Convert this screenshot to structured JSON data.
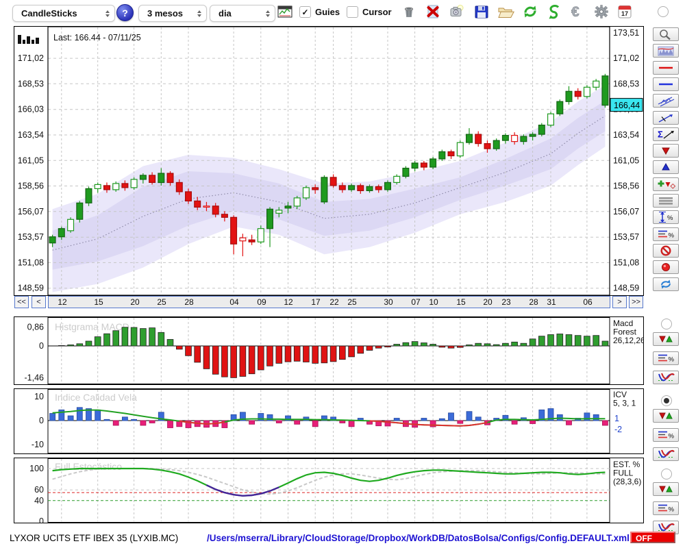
{
  "toolbar": {
    "chart_type": "CandleSticks",
    "period": "3 mesos",
    "timeframe": "dia",
    "help_label": "?",
    "guies_label": "Guies",
    "guies_checked": true,
    "cursor_label": "Cursor",
    "cursor_checked": false,
    "calendar_day": "17",
    "action_icons": [
      {
        "name": "trash-icon"
      },
      {
        "name": "delete-icon"
      },
      {
        "name": "snapshot-icon"
      },
      {
        "name": "save-icon"
      },
      {
        "name": "open-folder-icon"
      },
      {
        "name": "refresh-icon"
      },
      {
        "name": "sync-icon"
      },
      {
        "name": "euro-icon"
      },
      {
        "name": "settings-gear-icon"
      },
      {
        "name": "calendar-icon"
      }
    ]
  },
  "scrollbar": {
    "left_fast": "<<",
    "left": "<",
    "right": ">",
    "right_fast": ">>"
  },
  "sidebar": {
    "tools": [
      {
        "name": "zoom-tool"
      },
      {
        "name": "indicator-chart-tool"
      },
      {
        "name": "red-line-tool"
      },
      {
        "name": "blue-line-tool"
      },
      {
        "name": "channel-tool"
      },
      {
        "name": "trendline-tool"
      },
      {
        "name": "sigma-trend-tool"
      },
      {
        "name": "down-arrow-tool"
      },
      {
        "name": "up-arrow-tool"
      },
      {
        "name": "signal-markers-tool"
      },
      {
        "name": "levels-tool"
      },
      {
        "name": "range-percent-tool"
      },
      {
        "name": "lines-percent-tool"
      },
      {
        "name": "disable-tool"
      },
      {
        "name": "record-tool"
      },
      {
        "name": "refresh-chart-tool"
      }
    ],
    "panel_groups": [
      {
        "panel": "macd",
        "selected": false,
        "buttons": [
          "updown-arrows-tool",
          "lines-percent-tool",
          "curve-tool"
        ]
      },
      {
        "panel": "icv",
        "selected": true,
        "buttons": [
          "updown-arrows-tool",
          "lines-percent-tool",
          "curve-tool"
        ]
      },
      {
        "panel": "stoch",
        "selected": false,
        "buttons": [
          "updown-arrows-tool",
          "lines-percent-tool",
          "curve-tool"
        ]
      }
    ]
  },
  "status": {
    "symbol": "LYXOR UCITS ETF IBEX 35 (LYXIB.MC)",
    "config_path": "/Users/mserra/Library/CloudStorage/Dropbox/WorkDB/DatosBolsa/Configs/Config.DEFAULT.xml",
    "off_label": "OFF"
  },
  "colors": {
    "candle_up": "#1f9a1f",
    "candle_up_dark": "#156515",
    "candle_down": "#e31212",
    "candle_down_dark": "#a50d0d",
    "band_outer": "#eae7fa",
    "band_inner": "#dcd8f4",
    "band_mid": "#8e8aa8",
    "macd_up": "#2f9e2f",
    "macd_down": "#e01313",
    "icv_pos": "#3b6bd8",
    "icv_pos_dark": "#274a9e",
    "icv_neg": "#e81f78",
    "icv_neg_dark": "#aa1257",
    "icv_line": "#22a122",
    "icv_line_neg": "#e03030",
    "stoch_k": "#1faa1f",
    "stoch_d": "#c9c9c9",
    "stoch_purple": "#46249a",
    "level_red": "#dd2222",
    "level_green": "#2a9a2a",
    "price_tag": "#3ae6f0",
    "accent_blue": "#5577cc",
    "off_red": "#ea0000",
    "path_blue": "#1d12d2",
    "grid": "#c5c5c5",
    "watermark": "#cccccc"
  },
  "chart_data": [
    {
      "id": "main",
      "type": "candlestick",
      "last_label": "Last: 166.44 - 07/11/25",
      "last_price": 166.44,
      "last_price_label": "166,44",
      "ylim": [
        147.9,
        174.1
      ],
      "y_ticks": [
        171.02,
        168.53,
        166.03,
        163.54,
        161.05,
        158.56,
        156.07,
        153.57,
        151.08,
        148.59
      ],
      "y_tick_labels": [
        "171,02",
        "168,53",
        "166,03",
        "163,54",
        "161,05",
        "158,56",
        "156,07",
        "153,57",
        "151,08",
        "148,59"
      ],
      "top_partial_tick": 173.51,
      "top_partial_label": "173,51",
      "x_ticks": [
        {
          "label": "12",
          "i": 1
        },
        {
          "label": "15",
          "i": 5
        },
        {
          "label": "20",
          "i": 9
        },
        {
          "label": "25",
          "i": 12
        },
        {
          "label": "28",
          "i": 15
        },
        {
          "label": "04",
          "i": 20
        },
        {
          "label": "09",
          "i": 23
        },
        {
          "label": "12",
          "i": 26
        },
        {
          "label": "17",
          "i": 29
        },
        {
          "label": "22",
          "i": 31
        },
        {
          "label": "25",
          "i": 33
        },
        {
          "label": "30",
          "i": 37
        },
        {
          "label": "07",
          "i": 40
        },
        {
          "label": "10",
          "i": 42
        },
        {
          "label": "15",
          "i": 45
        },
        {
          "label": "20",
          "i": 48
        },
        {
          "label": "23",
          "i": 50
        },
        {
          "label": "28",
          "i": 53
        },
        {
          "label": "31",
          "i": 55
        },
        {
          "label": "06",
          "i": 59
        }
      ],
      "candles": [
        [
          153.0,
          153.8,
          152.6,
          153.6,
          "g"
        ],
        [
          153.6,
          154.6,
          153.3,
          154.4,
          "g"
        ],
        [
          154.2,
          155.5,
          154.0,
          155.3,
          "gh"
        ],
        [
          155.3,
          157.1,
          155.0,
          156.9,
          "g"
        ],
        [
          156.9,
          158.5,
          156.6,
          158.3,
          "g"
        ],
        [
          158.3,
          158.9,
          157.9,
          158.7,
          "gh"
        ],
        [
          158.6,
          158.9,
          157.9,
          158.2,
          "r"
        ],
        [
          158.2,
          159.0,
          158.0,
          158.8,
          "gh"
        ],
        [
          158.8,
          159.1,
          158.1,
          158.4,
          "r"
        ],
        [
          158.4,
          159.4,
          158.2,
          159.2,
          "gh"
        ],
        [
          159.2,
          159.8,
          158.8,
          159.6,
          "g"
        ],
        [
          159.6,
          159.9,
          158.7,
          158.9,
          "r"
        ],
        [
          158.9,
          160.3,
          158.6,
          159.8,
          "g"
        ],
        [
          159.8,
          160.0,
          158.6,
          158.9,
          "r"
        ],
        [
          158.9,
          159.2,
          157.7,
          158.0,
          "r"
        ],
        [
          158.0,
          158.3,
          156.8,
          157.1,
          "r"
        ],
        [
          157.1,
          157.5,
          156.2,
          156.5,
          "r"
        ],
        [
          156.5,
          157.0,
          156.1,
          156.6,
          "rh"
        ],
        [
          156.6,
          156.9,
          155.5,
          155.8,
          "r"
        ],
        [
          155.8,
          156.1,
          155.1,
          155.5,
          "r"
        ],
        [
          155.5,
          155.7,
          151.9,
          152.9,
          "r"
        ],
        [
          153.2,
          153.9,
          151.7,
          153.5,
          "rh"
        ],
        [
          153.3,
          153.8,
          152.8,
          153.1,
          "r"
        ],
        [
          153.1,
          154.7,
          152.9,
          154.4,
          "gh"
        ],
        [
          154.4,
          156.5,
          152.6,
          156.3,
          "g"
        ],
        [
          155.9,
          156.5,
          155.5,
          156.2,
          "gh"
        ],
        [
          156.4,
          157.0,
          155.9,
          156.6,
          "g"
        ],
        [
          156.6,
          157.6,
          156.3,
          157.4,
          "gh"
        ],
        [
          157.4,
          158.6,
          157.2,
          158.4,
          "gh"
        ],
        [
          158.4,
          158.7,
          157.8,
          158.2,
          "r"
        ],
        [
          157.0,
          159.6,
          156.8,
          159.4,
          "g"
        ],
        [
          159.4,
          159.7,
          158.4,
          158.6,
          "r"
        ],
        [
          158.6,
          158.9,
          157.9,
          158.2,
          "r"
        ],
        [
          158.2,
          158.8,
          158.0,
          158.6,
          "g"
        ],
        [
          158.6,
          158.8,
          157.8,
          158.1,
          "r"
        ],
        [
          158.1,
          158.7,
          157.9,
          158.5,
          "g"
        ],
        [
          158.5,
          158.7,
          157.9,
          158.2,
          "r"
        ],
        [
          158.2,
          159.1,
          158.0,
          158.9,
          "g"
        ],
        [
          158.9,
          159.7,
          158.7,
          159.5,
          "gh"
        ],
        [
          159.5,
          160.5,
          159.3,
          160.3,
          "g"
        ],
        [
          160.3,
          161.0,
          160.0,
          160.8,
          "g"
        ],
        [
          160.8,
          161.0,
          160.1,
          160.4,
          "r"
        ],
        [
          160.4,
          161.4,
          160.2,
          161.2,
          "g"
        ],
        [
          161.2,
          162.1,
          161.0,
          161.9,
          "g"
        ],
        [
          161.9,
          162.1,
          161.2,
          161.5,
          "r"
        ],
        [
          161.5,
          163.0,
          161.3,
          162.8,
          "gh"
        ],
        [
          162.8,
          164.2,
          162.6,
          163.6,
          "g"
        ],
        [
          163.6,
          163.9,
          162.4,
          162.7,
          "r"
        ],
        [
          162.7,
          163.0,
          161.8,
          162.2,
          "r"
        ],
        [
          162.2,
          163.2,
          162.0,
          163.0,
          "g"
        ],
        [
          163.0,
          163.7,
          162.7,
          163.5,
          "g"
        ],
        [
          163.5,
          163.8,
          162.6,
          162.9,
          "rh"
        ],
        [
          162.9,
          163.6,
          162.6,
          163.4,
          "g"
        ],
        [
          163.4,
          163.8,
          163.0,
          163.6,
          "g"
        ],
        [
          163.6,
          164.7,
          163.4,
          164.5,
          "g"
        ],
        [
          164.5,
          165.8,
          164.3,
          165.6,
          "gh"
        ],
        [
          165.6,
          167.0,
          165.4,
          166.8,
          "g"
        ],
        [
          166.8,
          168.3,
          166.5,
          167.8,
          "g"
        ],
        [
          167.8,
          168.1,
          167.0,
          167.3,
          "r"
        ],
        [
          167.3,
          168.4,
          167.1,
          168.2,
          "gh"
        ],
        [
          168.2,
          169.0,
          167.9,
          168.8,
          "gh"
        ],
        [
          169.3,
          169.5,
          166.2,
          166.44,
          "g"
        ]
      ],
      "bands": {
        "idx": [
          0,
          5,
          10,
          15,
          20,
          25,
          30,
          35,
          40,
          45,
          50,
          55,
          58,
          61
        ],
        "outer_upper": [
          156.3,
          157.8,
          160.5,
          161.6,
          161.3,
          160.2,
          158.8,
          159.0,
          159.9,
          161.0,
          162.8,
          164.8,
          166.8,
          168.4
        ],
        "inner_upper": [
          154.2,
          155.7,
          158.5,
          160.0,
          159.8,
          158.8,
          157.0,
          157.3,
          158.3,
          159.4,
          161.2,
          163.2,
          165.2,
          166.9
        ],
        "middle": [
          152.3,
          153.4,
          155.6,
          157.3,
          157.9,
          157.0,
          155.4,
          155.8,
          156.9,
          158.4,
          159.9,
          161.7,
          163.7,
          165.4
        ],
        "inner_lower": [
          150.4,
          151.2,
          152.7,
          154.7,
          156.1,
          155.3,
          153.7,
          154.2,
          155.5,
          157.2,
          158.6,
          160.2,
          162.2,
          163.9
        ],
        "outer_lower": [
          148.2,
          149.0,
          150.6,
          152.9,
          154.6,
          153.8,
          151.9,
          152.6,
          154.0,
          155.8,
          157.0,
          158.6,
          160.6,
          162.4
        ]
      }
    },
    {
      "id": "macd",
      "type": "bar",
      "watermark": "Histgrama MACD",
      "label_lines": [
        "Macd",
        "Forest",
        "26,12,26"
      ],
      "y_ticks": [
        0.86,
        0,
        -1.46
      ],
      "y_tick_labels": [
        "0,86",
        "0",
        "-1,46"
      ],
      "values": [
        0.0,
        0.02,
        0.05,
        0.1,
        0.22,
        0.42,
        0.56,
        0.7,
        0.86,
        0.85,
        0.8,
        0.83,
        0.62,
        0.3,
        -0.15,
        -0.45,
        -0.75,
        -1.05,
        -1.3,
        -1.42,
        -1.46,
        -1.4,
        -1.28,
        -1.1,
        -0.92,
        -0.8,
        -0.73,
        -0.7,
        -0.74,
        -0.8,
        -0.78,
        -0.72,
        -0.62,
        -0.5,
        -0.34,
        -0.2,
        -0.1,
        -0.05,
        0.08,
        0.15,
        0.2,
        0.14,
        0.08,
        -0.06,
        -0.1,
        -0.07,
        0.05,
        0.12,
        0.1,
        0.06,
        0.12,
        0.18,
        0.12,
        0.32,
        0.45,
        0.52,
        0.55,
        0.52,
        0.48,
        0.45,
        0.48,
        0.22
      ]
    },
    {
      "id": "icv",
      "type": "bar+line",
      "watermark": "Indice Calidad Vela",
      "label_lines": [
        "ICV",
        "5, 3, 1"
      ],
      "aux_labels": [
        "1",
        "-2"
      ],
      "y_ticks": [
        10,
        0,
        -10
      ],
      "y_tick_labels": [
        "10",
        "0",
        "-10"
      ],
      "bars": [
        3,
        4.5,
        2,
        5.5,
        5,
        4.5,
        0.5,
        -2,
        1.5,
        0.5,
        -2,
        -1,
        3.5,
        -3,
        -2.5,
        -3,
        -2.5,
        -2.8,
        -2.5,
        -3,
        2.5,
        3.5,
        -1.5,
        3,
        2.5,
        -1,
        2,
        -1.5,
        1.5,
        -2.5,
        2,
        1.5,
        -1,
        -2.5,
        1,
        -1.5,
        -2.2,
        -2.3,
        1,
        -2.5,
        -2.8,
        1,
        -2.6,
        0.8,
        3.2,
        -1.2,
        3.8,
        1.5,
        -1.8,
        1,
        2.2,
        -1.5,
        1.2,
        -1.3,
        4.5,
        5,
        2.5,
        -1.8,
        1,
        3.2,
        2.5,
        -2
      ],
      "line": [
        3.2,
        3.5,
        3.8,
        4.2,
        4.4,
        4.4,
        4.0,
        3.5,
        3.0,
        2.4,
        1.8,
        1.2,
        0.7,
        0.3,
        -0.2,
        -0.7,
        -1.1,
        -1.4,
        -1.2,
        -0.6,
        0.2,
        0.6,
        0.7,
        0.7,
        0.6,
        0.6,
        0.5,
        0.5,
        0.5,
        0.4,
        0.4,
        0.3,
        0.2,
        0.1,
        0.0,
        -0.1,
        -0.3,
        -0.6,
        -0.9,
        -1.3,
        -1.6,
        -1.8,
        -1.9,
        -2.0,
        -2.1,
        -2.2,
        -2.0,
        -1.5,
        -0.8,
        0.2,
        0.5,
        0.5,
        0.4,
        0.3,
        0.5,
        0.8,
        1.0,
        0.9,
        0.7,
        0.8,
        0.8,
        0.8
      ]
    },
    {
      "id": "stoch",
      "type": "line",
      "watermark": "Full Estocástico",
      "label_lines": [
        "EST. %",
        "FULL",
        "(28,3,6)"
      ],
      "y_ticks": [
        100,
        60,
        40,
        0
      ],
      "y_tick_labels": [
        "100",
        "60",
        "40",
        "0"
      ],
      "levels": {
        "red": 55,
        "green": 40
      },
      "purple_range": [
        17,
        25
      ],
      "k": [
        96,
        98,
        99,
        100,
        100,
        100,
        100,
        100,
        100,
        100,
        100,
        99,
        97,
        94,
        90,
        84,
        77,
        69,
        61,
        55,
        51,
        49,
        50,
        53,
        58,
        65,
        73,
        81,
        88,
        92,
        93,
        91,
        87,
        82,
        78,
        76,
        78,
        82,
        87,
        91,
        94,
        96,
        97,
        97,
        96,
        95,
        94,
        93,
        92,
        91,
        90,
        90,
        91,
        92,
        93,
        93,
        92,
        90,
        89,
        90,
        92,
        93
      ],
      "d": [
        80,
        85,
        90,
        94,
        97,
        99,
        100,
        100,
        100,
        100,
        100,
        100,
        99,
        98,
        96,
        93,
        89,
        84,
        78,
        72,
        66,
        60,
        56,
        53,
        52,
        54,
        58,
        64,
        71,
        78,
        84,
        88,
        90,
        90,
        88,
        85,
        82,
        80,
        79,
        81,
        85,
        89,
        92,
        94,
        95,
        96,
        96,
        96,
        95,
        94,
        93,
        92,
        91,
        90,
        90,
        91,
        92,
        92,
        92,
        91,
        90,
        90
      ]
    }
  ]
}
